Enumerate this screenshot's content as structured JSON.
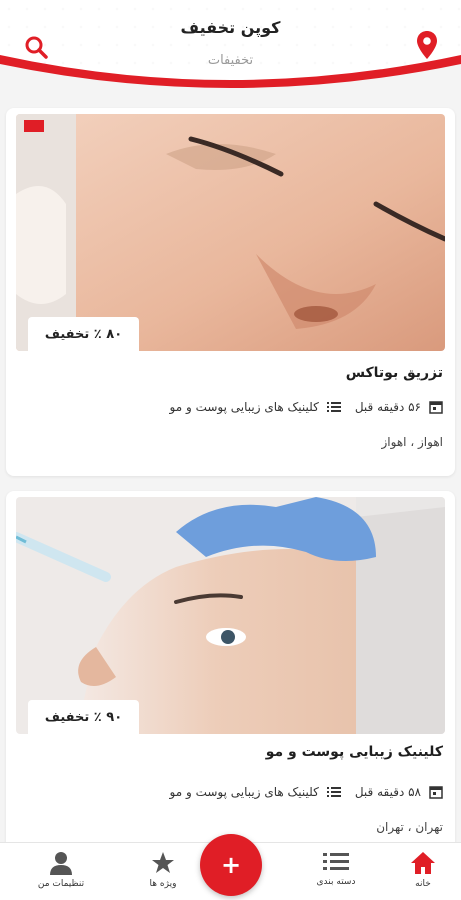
{
  "header": {
    "title": "کوپن تخفیف",
    "subtitle": "تخفیفات",
    "accent_color": "#e01e26"
  },
  "cards": [
    {
      "discount": "۸۰ ٪ تخفیف",
      "title": "تزریق بوتاکس",
      "time": "۵۶ دقیقه قبل",
      "category": "کلینیک های زیبایی پوست و مو",
      "location": "اهواز ، اهواز"
    },
    {
      "discount": "۹۰ ٪ تخفیف",
      "title": "کلینیک زیبایی پوست و مو",
      "time": "۵۸ دقیقه قبل",
      "category": "کلینیک های زیبایی پوست و مو",
      "location": "تهران ، تهران"
    }
  ],
  "nav": {
    "home": "خانه",
    "categories": "دسته بندی",
    "add": "+",
    "specials": "ویژه ها",
    "settings": "تنظیمات من"
  },
  "icons": {
    "search": "search-icon",
    "location": "location-pin-icon",
    "calendar": "calendar-icon",
    "list": "list-icon",
    "home": "home-icon",
    "star": "star-icon",
    "user": "user-icon"
  }
}
